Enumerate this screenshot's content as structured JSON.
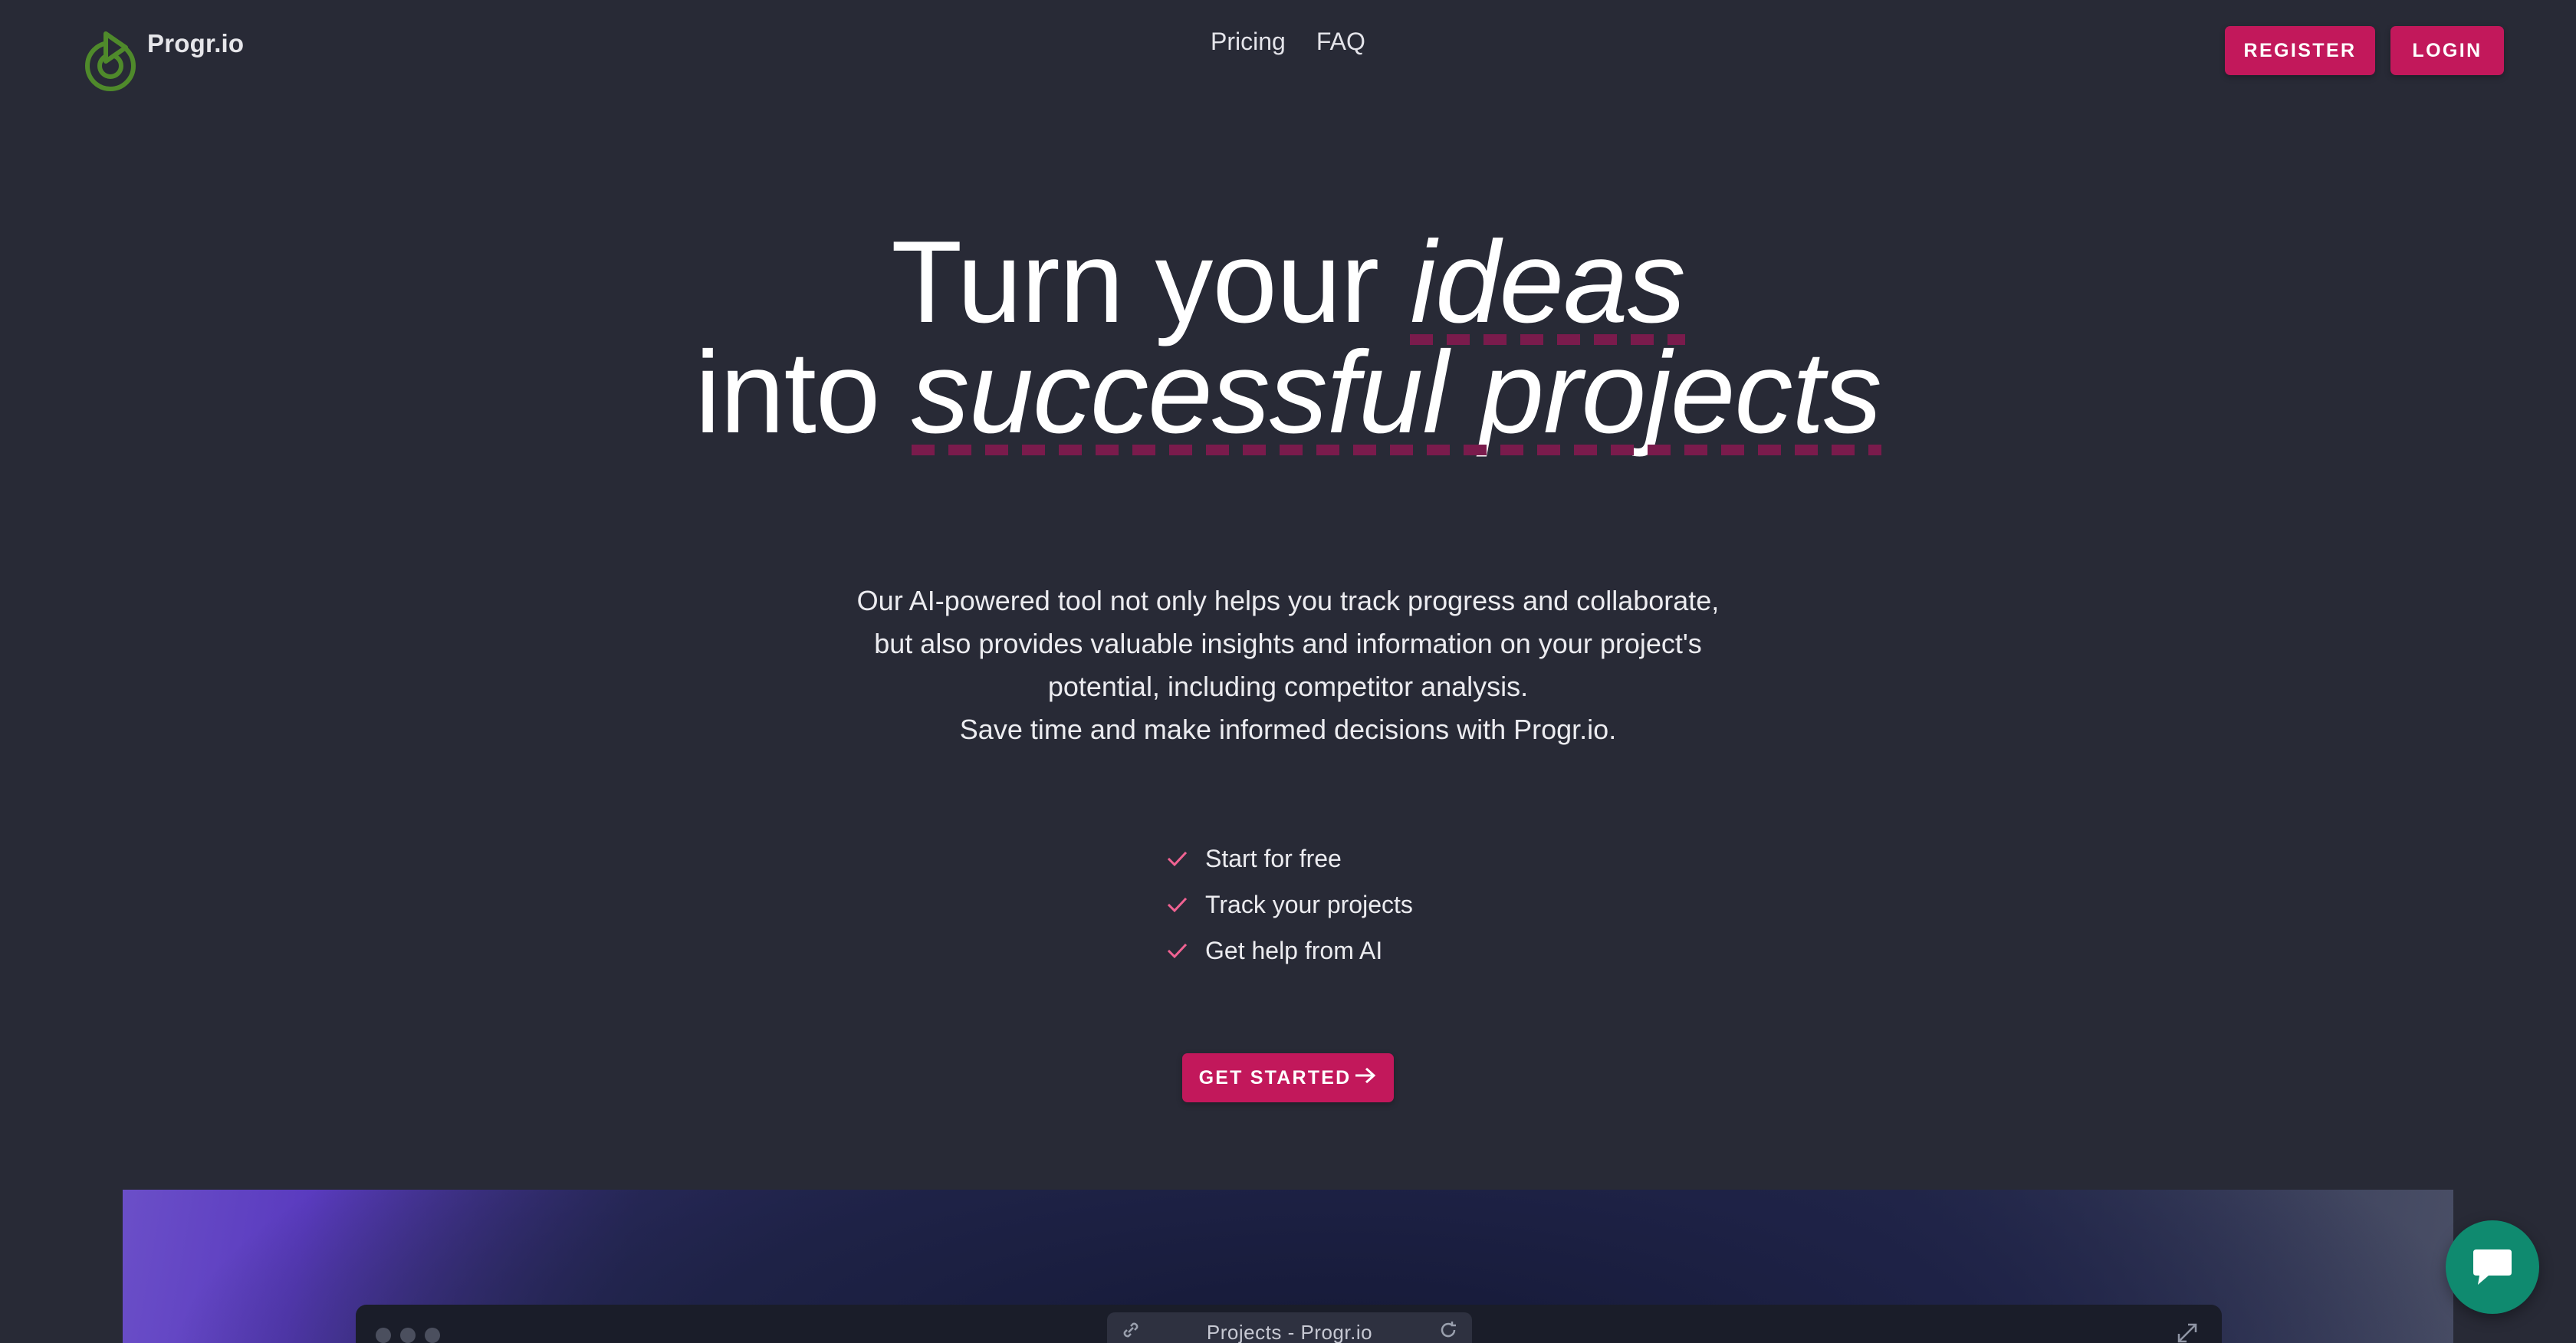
{
  "brand": {
    "name": "Progr.io",
    "logo_color": "#4f8a2b"
  },
  "nav": {
    "items": [
      {
        "label": "Pricing"
      },
      {
        "label": "FAQ"
      }
    ]
  },
  "auth": {
    "register_label": "REGISTER",
    "login_label": "LOGIN"
  },
  "hero": {
    "line1_prefix": "Turn your ",
    "line1_highlight": "ideas",
    "line2_prefix": "into ",
    "line2_highlight": "successful projects"
  },
  "description": {
    "lines": [
      "Our AI-powered tool not only helps you track progress and collaborate,",
      "but also provides valuable insights and information on your project's",
      "potential, including competitor analysis.",
      "Save time and make informed decisions with Progr.io."
    ]
  },
  "features": [
    {
      "label": "Start for free",
      "icon": "check-icon"
    },
    {
      "label": "Track your projects",
      "icon": "check-icon"
    },
    {
      "label": "Get help from AI",
      "icon": "check-icon"
    }
  ],
  "cta": {
    "label": "GET STARTED",
    "icon": "arrow-right-icon"
  },
  "preview": {
    "tab_title": "Projects - Progr.io",
    "icons": [
      "link-icon",
      "refresh-icon",
      "expand-icon"
    ]
  },
  "chat": {
    "icon": "chat-bubble-icon"
  },
  "colors": {
    "background": "#282a36",
    "accent": "#c2185b",
    "underline": "#7a1b4c",
    "check": "#f06292",
    "chat": "#0f8a6f"
  }
}
